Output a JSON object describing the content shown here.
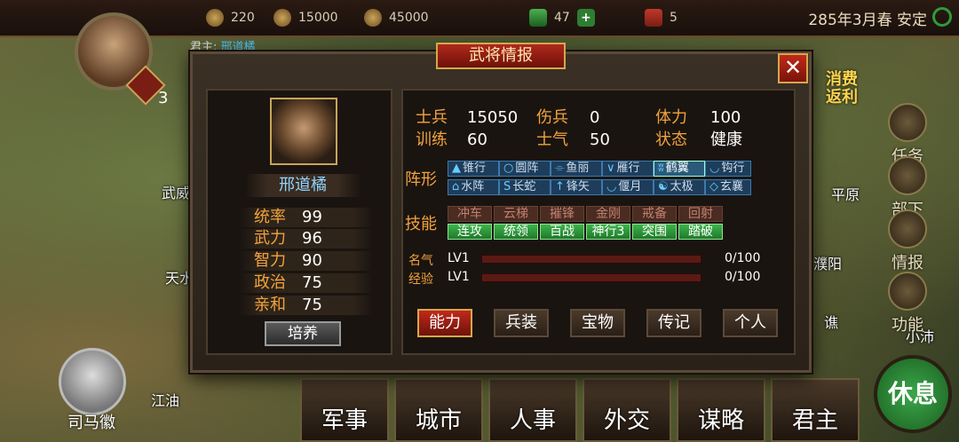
{
  "topbar": {
    "resources": [
      {
        "icon": "gold-icon",
        "value": "220"
      },
      {
        "icon": "coin-pile-icon",
        "value": "15000"
      },
      {
        "icon": "grain-icon",
        "value": "45000"
      },
      {
        "icon": "jade-icon",
        "value": "47"
      },
      {
        "icon": "token-icon",
        "value": "5"
      }
    ],
    "date": "285年3月春",
    "status": "安定"
  },
  "lord": {
    "num": "3",
    "ruler_label": "君主",
    "ruler_name": "邢道橘"
  },
  "map": {
    "cities": [
      "武威",
      "天水",
      "江油",
      "平原",
      "濮阳",
      "谯",
      "小沛"
    ]
  },
  "side_nav": {
    "consume": [
      "消费",
      "返利"
    ],
    "items": [
      "任务",
      "部下",
      "情报",
      "功能"
    ]
  },
  "advisor": {
    "name": "司马徽"
  },
  "rest_button": "休息",
  "bottom_nav": [
    "军事",
    "城市",
    "人事",
    "外交",
    "谋略",
    "君主"
  ],
  "dialog": {
    "title": "武将情报",
    "close": "✕",
    "general": {
      "name": "邢道橘",
      "attributes": [
        {
          "label": "统率",
          "value": "99"
        },
        {
          "label": "武力",
          "value": "96"
        },
        {
          "label": "智力",
          "value": "90"
        },
        {
          "label": "政治",
          "value": "75"
        },
        {
          "label": "亲和",
          "value": "75"
        }
      ],
      "cultivate": "培养"
    },
    "stats": [
      {
        "label": "士兵",
        "value": "15050"
      },
      {
        "label": "伤兵",
        "value": "0"
      },
      {
        "label": "体力",
        "value": "100"
      },
      {
        "label": "训练",
        "value": "60"
      },
      {
        "label": "士气",
        "value": "50"
      },
      {
        "label": "状态",
        "value": "健康"
      }
    ],
    "formation_label": "阵形",
    "formations": [
      {
        "label": "锥行",
        "active": true
      },
      {
        "label": "圆阵",
        "active": true
      },
      {
        "label": "鱼丽",
        "active": true
      },
      {
        "label": "雁行",
        "active": true
      },
      {
        "label": "鹤翼",
        "active": true
      },
      {
        "label": "钩行",
        "active": true
      },
      {
        "label": "水阵",
        "active": true
      },
      {
        "label": "长蛇",
        "active": true
      },
      {
        "label": "锋矢",
        "active": true
      },
      {
        "label": "偃月",
        "active": true
      },
      {
        "label": "太极",
        "active": true
      },
      {
        "label": "玄襄",
        "active": true
      }
    ],
    "skill_label": "技能",
    "skills": [
      {
        "label": "冲车",
        "on": false
      },
      {
        "label": "云梯",
        "on": false
      },
      {
        "label": "摧锋",
        "on": false
      },
      {
        "label": "金刚",
        "on": false
      },
      {
        "label": "戒备",
        "on": false
      },
      {
        "label": "回射",
        "on": false
      },
      {
        "label": "连攻",
        "on": true
      },
      {
        "label": "统领",
        "on": true
      },
      {
        "label": "百战",
        "on": true
      },
      {
        "label": "神行3",
        "on": true
      },
      {
        "label": "突围",
        "on": true
      },
      {
        "label": "踏破",
        "on": true
      }
    ],
    "fame": {
      "label": "名气",
      "level": "LV1",
      "value": "0/100",
      "progress": 0
    },
    "exp": {
      "label": "经验",
      "level": "LV1",
      "value": "0/100",
      "progress": 0
    },
    "tabs": [
      "能力",
      "兵装",
      "宝物",
      "传记",
      "个人"
    ],
    "active_tab": "能力"
  }
}
